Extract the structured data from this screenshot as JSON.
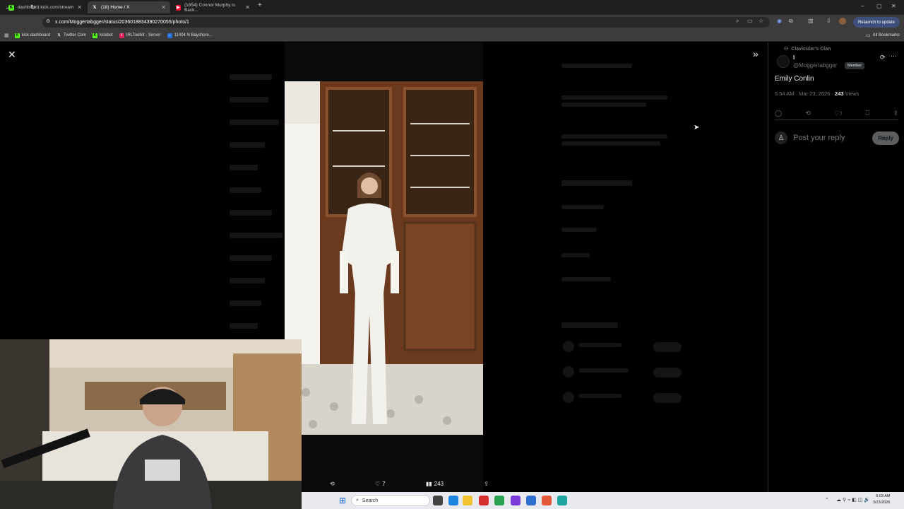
{
  "browser": {
    "tabs": [
      {
        "label": "dashboard.kick.com/stream",
        "icon": "kick-icon",
        "active": false
      },
      {
        "label": "(18) Home / X",
        "icon": "x-icon",
        "active": true
      },
      {
        "label": "(1854) Connor Murphy is Back...",
        "icon": "youtube-icon",
        "active": false
      }
    ],
    "url": "x.com/Moggertabgger/status/2036018834390270055/photo/1",
    "relaunch_label": "Relaunch to update",
    "bookmarks": [
      {
        "label": "kick dashboard",
        "icon": "kick-icon"
      },
      {
        "label": "Twitter Com",
        "icon": "x-icon"
      },
      {
        "label": "kickbot",
        "icon": "kickbot-icon"
      },
      {
        "label": "IRLToolkit - Server",
        "icon": "irltoolkit-icon"
      },
      {
        "label": "11404 N Bayshore...",
        "icon": "house-icon"
      }
    ],
    "all_bookmarks_label": "All Bookmarks"
  },
  "tweet": {
    "community": "Clavicular's Clan",
    "author_name": "I",
    "handle": "@Moggertabgger",
    "badge": "Member",
    "text": "Emily Conlin",
    "time": "5:54 AM · Mar 23, 2026 · ",
    "views_count": "243",
    "views_label": " Views",
    "likes": "7",
    "reply_placeholder": "Post your reply",
    "reply_button": "Reply"
  },
  "photo_actions": {
    "likes": "7",
    "views": "243"
  },
  "taskbar": {
    "search_placeholder": "Search",
    "time": "6:03 AM",
    "date": "3/23/2026"
  }
}
